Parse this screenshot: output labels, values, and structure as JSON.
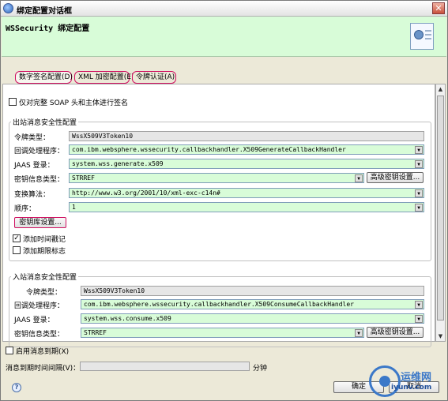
{
  "window": {
    "title": "绑定配置对话框",
    "close_glyph": "✕"
  },
  "banner": {
    "title": "WSSecurity 绑定配置",
    "icon": "certificate-icon"
  },
  "tabs": [
    {
      "label": "数字签名配置(D)"
    },
    {
      "label": "XML 加密配置(E)"
    },
    {
      "label": "令牌认证(A)"
    }
  ],
  "sign_only_checkbox": {
    "label": "仅对完整 SOAP 头和主体进行签名",
    "checked": false
  },
  "outbound": {
    "title": "出站消息安全性配置",
    "token_type": {
      "label": "令牌类型：",
      "value": "WssX509V3Token10"
    },
    "callback": {
      "label": "回调处理程序：",
      "value": "com.ibm.websphere.wssecurity.callbackhandler.X509GenerateCallbackHandler"
    },
    "jaas": {
      "label": "JAAS 登录：",
      "value": "system.wss.generate.x509"
    },
    "key_info": {
      "label": "密钥信息类型：",
      "value": "STRREF",
      "button": "高级密钥设置..."
    },
    "transform": {
      "label": "变换算法：",
      "value": "http://www.w3.org/2001/10/xml-exc-c14n#"
    },
    "order": {
      "label": "顺序：",
      "value": "1"
    },
    "keystore_button": "密钥库设置...",
    "add_timestamp": {
      "label": "添加时间戳记",
      "checked": true
    },
    "add_expiry": {
      "label": "添加期限标志",
      "checked": false
    }
  },
  "inbound": {
    "title": "入站消息安全性配置",
    "token_type": {
      "label": "令牌类型：",
      "value": "WssX509V3Token10"
    },
    "callback": {
      "label": "回调处理程序：",
      "value": "com.ibm.websphere.wssecurity.callbackhandler.X509ConsumeCallbackHandler"
    },
    "jaas": {
      "label": "JAAS 登录：",
      "value": "system.wss.consume.x509"
    },
    "key_info": {
      "label": "密钥信息类型：",
      "value": "STRREF",
      "button": "高级密钥设置..."
    }
  },
  "enable_expiry": {
    "label": "启用消息到期(X)",
    "checked": false
  },
  "expiry_interval": {
    "label": "消息到期时间间隔(V)：",
    "value": "",
    "unit": "分钟"
  },
  "buttons": {
    "ok": "确定",
    "cancel": "取消"
  },
  "watermark": {
    "title": "运维网",
    "subtitle": "iyunv.com"
  },
  "colors": {
    "field_bg": "#d8fcd8",
    "banner_bg": "#d8fcd8",
    "highlight_ring": "#d01060"
  }
}
